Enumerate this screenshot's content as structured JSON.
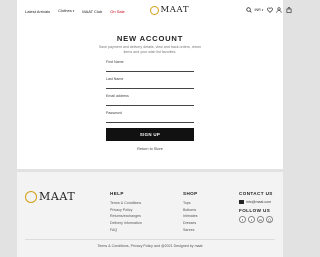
{
  "header": {
    "nav": [
      {
        "label": "Latest Arrivals"
      },
      {
        "label": "Clothes"
      },
      {
        "label": "MAAT Club"
      },
      {
        "label": "On Sale"
      }
    ],
    "logo_text": "MAAT",
    "currency": "INR",
    "icons": [
      "search-icon",
      "chevron-down-icon",
      "heart-icon",
      "user-icon",
      "bag-icon"
    ],
    "brand_color": "#d4a017",
    "sale_color": "#d0021b"
  },
  "form": {
    "title": "NEW ACCOUNT",
    "subtitle": "Save payment and delivery details, view and track orders, return items and your wish list favorites.",
    "fields": [
      {
        "label": "First Name",
        "value": ""
      },
      {
        "label": "Last Name",
        "value": ""
      },
      {
        "label": "Email address",
        "value": ""
      },
      {
        "label": "Password",
        "value": ""
      }
    ],
    "submit_label": "SIGN UP",
    "return_label": "Return to Store"
  },
  "footer": {
    "logo_text": "MAAT",
    "help": {
      "heading": "HELP",
      "links": [
        "Terms & Conditions",
        "Privacy Policy",
        "Returns/exchanges",
        "Delivery information",
        "FAQ"
      ]
    },
    "shop": {
      "heading": "SHOP",
      "links": [
        "Tops",
        "Bottoms",
        "Intimates",
        "Dresses",
        "Sarees"
      ]
    },
    "contact": {
      "heading": "CONTACT US",
      "email": "info@maat.com",
      "follow_heading": "FOLLOW US",
      "socials": [
        "facebook-icon",
        "twitter-icon",
        "linkedin-icon",
        "instagram-icon"
      ]
    },
    "copyright": "Terms & Conditions, Privacy Policy and @2021 Designed by maat"
  }
}
